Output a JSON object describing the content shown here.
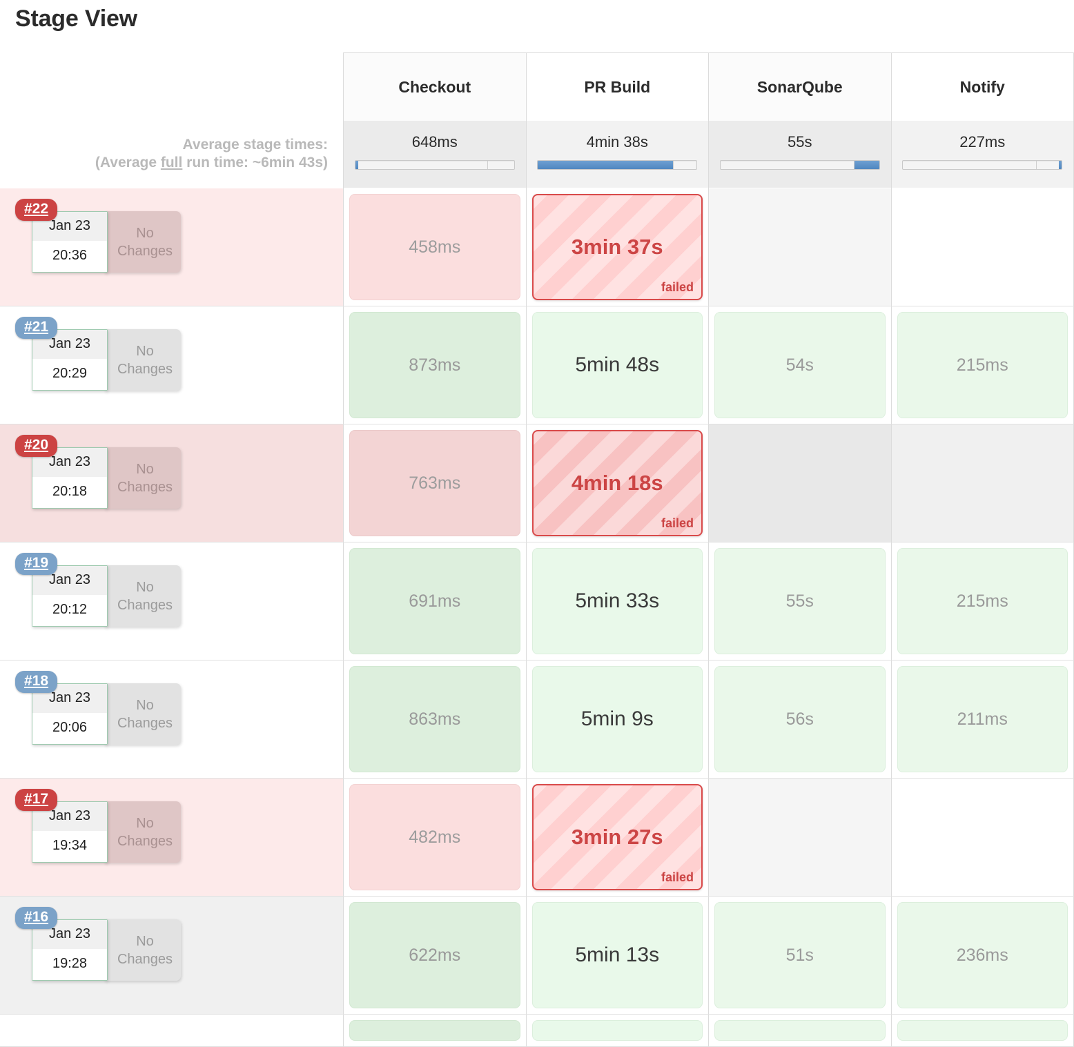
{
  "page": {
    "title": "Stage View"
  },
  "average": {
    "line1": "Average stage times:",
    "line2_pre": "(Average ",
    "line2_underline": "full",
    "line2_post": " run time: ~6min 43s)"
  },
  "stages": [
    {
      "name": "Checkout",
      "avg": "648ms",
      "bar": {
        "fill_pct": 2,
        "fill_side": "left",
        "tick_pct": 83
      }
    },
    {
      "name": "PR Build",
      "avg": "4min 38s",
      "bar": {
        "fill_pct": 85,
        "fill_side": "left",
        "tick_pct": 85
      }
    },
    {
      "name": "SonarQube",
      "avg": "55s",
      "bar": {
        "fill_pct": 16,
        "fill_side": "right",
        "tick_pct": 84
      }
    },
    {
      "name": "Notify",
      "avg": "227ms",
      "bar": {
        "fill_pct": 2,
        "fill_side": "right",
        "tick_pct": 84
      }
    }
  ],
  "changes_label": "No Changes",
  "failed_label": "failed",
  "colors": {
    "badge_success": "#7ba2c8",
    "badge_failed": "#cc4343",
    "cell_success": "#e9f9ea",
    "cell_failed": "#ffd0d0",
    "failed_border": "#d94a4a",
    "failed_text": "#cc4545",
    "progress_fill": "#4f86c0"
  },
  "builds": [
    {
      "id": "#22",
      "status": "failed",
      "row_style": "bg-fail",
      "date": "Jan 23",
      "time": "20:36",
      "cells": [
        {
          "text": "458ms",
          "type": "fail-dim"
        },
        {
          "text": "3min 37s",
          "type": "failed"
        },
        {
          "text": "",
          "type": "empty-gray"
        },
        {
          "text": "",
          "type": "empty-white"
        }
      ]
    },
    {
      "id": "#21",
      "status": "success",
      "row_style": "bg-white",
      "date": "Jan 23",
      "time": "20:29",
      "cells": [
        {
          "text": "873ms",
          "type": "ok-dim"
        },
        {
          "text": "5min 48s",
          "type": "ok-bright"
        },
        {
          "text": "54s",
          "type": "ok-soft"
        },
        {
          "text": "215ms",
          "type": "ok-soft"
        }
      ]
    },
    {
      "id": "#20",
      "status": "failed",
      "row_style": "bg-failhi",
      "date": "Jan 23",
      "time": "20:18",
      "cells": [
        {
          "text": "763ms",
          "type": "fail-dim-hi"
        },
        {
          "text": "4min 18s",
          "type": "failed-hi"
        },
        {
          "text": "",
          "type": "empty-gray2"
        },
        {
          "text": "",
          "type": "empty-gray3"
        }
      ]
    },
    {
      "id": "#19",
      "status": "success",
      "row_style": "bg-white",
      "date": "Jan 23",
      "time": "20:12",
      "cells": [
        {
          "text": "691ms",
          "type": "ok-dim"
        },
        {
          "text": "5min 33s",
          "type": "ok-bright"
        },
        {
          "text": "55s",
          "type": "ok-soft"
        },
        {
          "text": "215ms",
          "type": "ok-soft"
        }
      ]
    },
    {
      "id": "#18",
      "status": "success",
      "row_style": "bg-white",
      "date": "Jan 23",
      "time": "20:06",
      "cells": [
        {
          "text": "863ms",
          "type": "ok-dim"
        },
        {
          "text": "5min 9s",
          "type": "ok-bright"
        },
        {
          "text": "56s",
          "type": "ok-soft"
        },
        {
          "text": "211ms",
          "type": "ok-soft"
        }
      ]
    },
    {
      "id": "#17",
      "status": "failed",
      "row_style": "bg-fail",
      "date": "Jan 23",
      "time": "19:34",
      "cells": [
        {
          "text": "482ms",
          "type": "fail-dim"
        },
        {
          "text": "3min 27s",
          "type": "failed"
        },
        {
          "text": "",
          "type": "empty-gray"
        },
        {
          "text": "",
          "type": "empty-white"
        }
      ]
    },
    {
      "id": "#16",
      "status": "success",
      "row_style": "bg-hover",
      "date": "Jan 23",
      "time": "19:28",
      "cells": [
        {
          "text": "622ms",
          "type": "ok-dim"
        },
        {
          "text": "5min 13s",
          "type": "ok-bright"
        },
        {
          "text": "51s",
          "type": "ok-soft"
        },
        {
          "text": "236ms",
          "type": "ok-soft"
        }
      ]
    }
  ]
}
